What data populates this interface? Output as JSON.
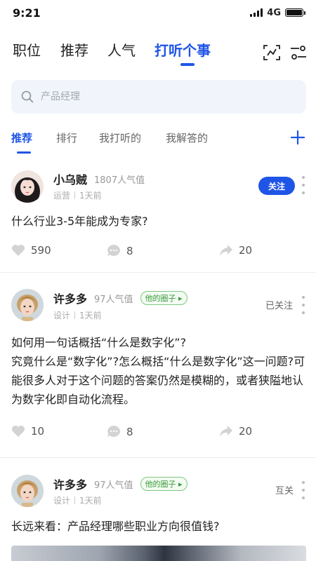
{
  "status": {
    "time": "9:21",
    "network": "4G"
  },
  "nav": {
    "tabs": [
      {
        "label": "职位"
      },
      {
        "label": "推荐"
      },
      {
        "label": "人气"
      },
      {
        "label": "打听个事"
      }
    ],
    "active_index": 3,
    "accent_color": "#1f55e6"
  },
  "search": {
    "placeholder": "产品经理",
    "icon": "search-icon"
  },
  "sub_tabs": {
    "tabs": [
      {
        "label": "推荐"
      },
      {
        "label": "排行"
      },
      {
        "label": "我打听的"
      },
      {
        "label": "我解答的"
      }
    ],
    "active_index": 0
  },
  "posts": [
    {
      "author": "小乌贼",
      "popularity": "1807人气值",
      "role": "运营",
      "time": "1天前",
      "follow_label": "关注",
      "text": "什么行业3-5年能成为专家?",
      "likes": "590",
      "comments": "8",
      "shares": "20"
    },
    {
      "author": "许多多",
      "popularity": "97人气值",
      "circle_tag": "他的圈子",
      "role": "设计",
      "time": "1天前",
      "follow_label": "已关注",
      "text": "如何用一句话概括“什么是数字化”?\n究竟什么是“数字化”?怎么概括“什么是数字化”这一问题?可能很多人对于这个问题的答案仍然是模糊的，或者狭隘地认为数字化即自动化流程。",
      "likes": "10",
      "comments": "8",
      "shares": "20"
    },
    {
      "author": "许多多",
      "popularity": "97人气值",
      "circle_tag": "他的圈子",
      "role": "设计",
      "time": "1天前",
      "follow_label": "互关",
      "text": "长远来看：产品经理哪些职业方向很值钱?"
    }
  ]
}
